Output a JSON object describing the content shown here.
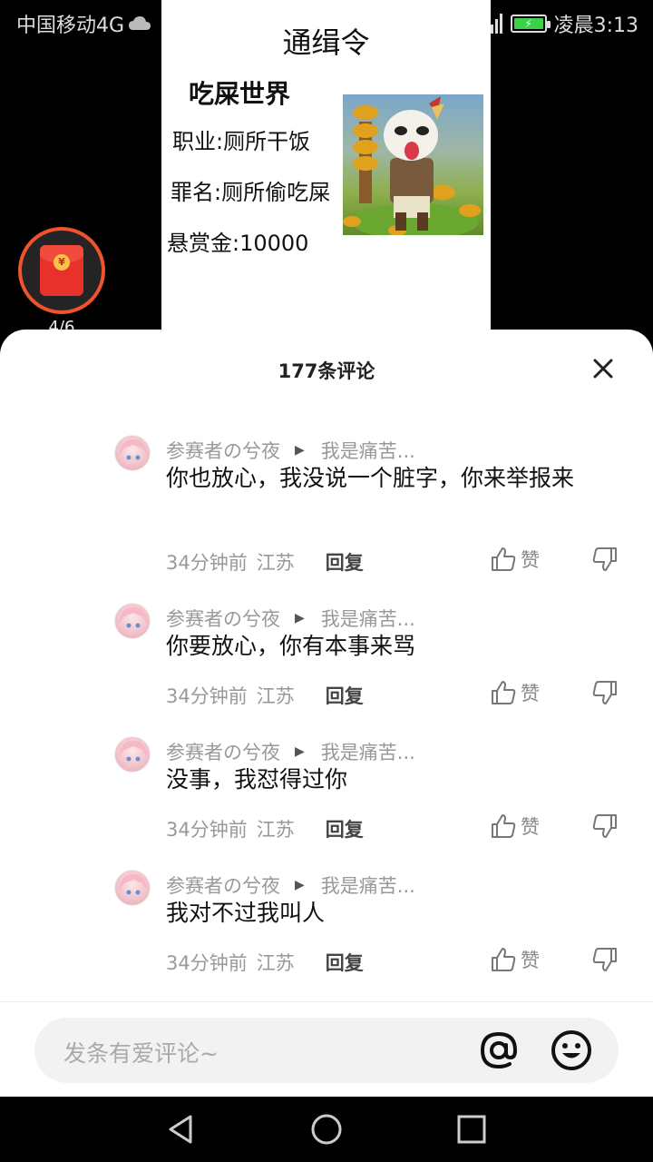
{
  "status_bar": {
    "carrier": "中国移动4G",
    "time": "凌晨3:13"
  },
  "poster": {
    "title": "通缉令",
    "name": "吃屎世界",
    "job": "职业:厕所干饭",
    "crime": "罪名:厕所偷吃屎",
    "bounty": "悬赏金:10000"
  },
  "red_packet": {
    "count": "4/6"
  },
  "comments_sheet": {
    "title": "177条评论",
    "comments": [
      {
        "user": "参赛者の兮夜",
        "reply_to": "我是痛苦...",
        "text": "你也放心，我没说一个脏字，你来举报来",
        "time": "34分钟前",
        "location": "江苏",
        "reply_label": "回复",
        "like_label": "赞"
      },
      {
        "user": "参赛者の兮夜",
        "reply_to": "我是痛苦...",
        "text": "你要放心，你有本事来骂",
        "time": "34分钟前",
        "location": "江苏",
        "reply_label": "回复",
        "like_label": "赞"
      },
      {
        "user": "参赛者の兮夜",
        "reply_to": "我是痛苦...",
        "text": "没事，我怼得过你",
        "time": "34分钟前",
        "location": "江苏",
        "reply_label": "回复",
        "like_label": "赞"
      },
      {
        "user": "参赛者の兮夜",
        "reply_to": "我是痛苦...",
        "text": "我对不过我叫人",
        "time": "34分钟前",
        "location": "江苏",
        "reply_label": "回复",
        "like_label": "赞"
      }
    ]
  },
  "input": {
    "placeholder": "发条有爱评论~"
  },
  "colors": {
    "accent_red": "#e8312b",
    "battery_green": "#3bd24a"
  }
}
